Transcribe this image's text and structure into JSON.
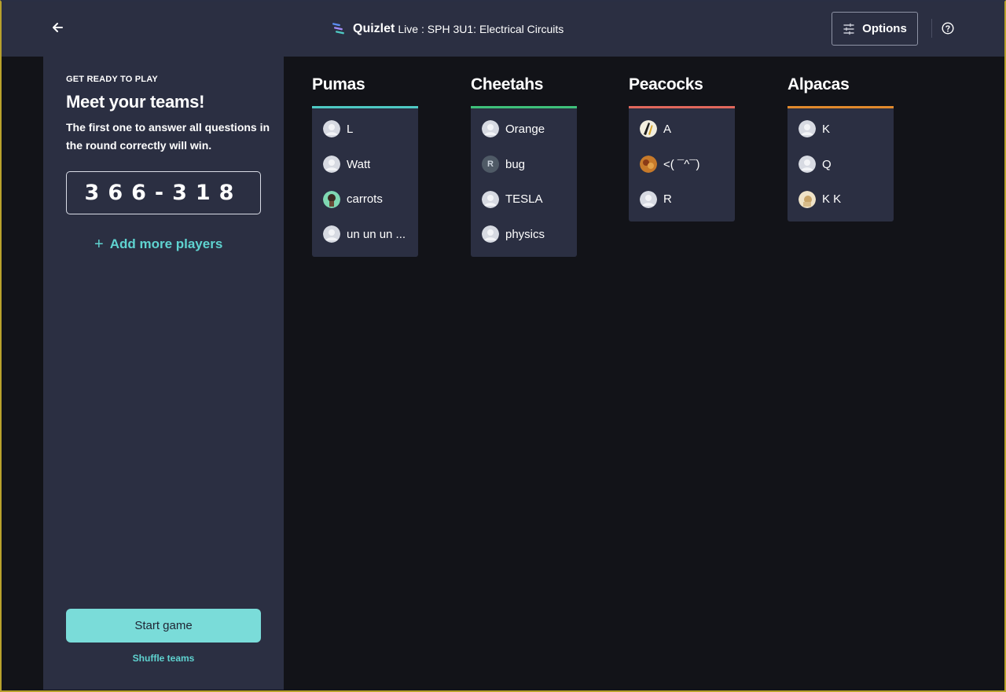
{
  "header": {
    "brand": "Quizlet",
    "mode": "Live",
    "set_title": ": SPH 3U1: Electrical Circuits",
    "options_label": "Options",
    "icons": [
      "arrow-left-icon",
      "quizlet-logo-icon",
      "sliders-icon",
      "help-circle-icon"
    ]
  },
  "sidebar": {
    "kicker": "GET READY TO PLAY",
    "headline": "Meet your teams!",
    "description": "The first one to answer all questions in the round correctly will win.",
    "join_code": "366-318",
    "add_players_label": "Add more players",
    "start_label": "Start game",
    "shuffle_label": "Shuffle teams"
  },
  "colors": {
    "accent": "#5fd3d0",
    "start_button": "#7adcd9",
    "panel": "#2b2f42",
    "background": "#121318"
  },
  "teams": [
    {
      "name": "Pumas",
      "color": "#4ec9c3",
      "players": [
        {
          "name": "L",
          "avatar": "default"
        },
        {
          "name": "Watt",
          "avatar": "default"
        },
        {
          "name": "carrots",
          "avatar": "photo-green"
        },
        {
          "name": "un un un ...",
          "avatar": "default"
        }
      ]
    },
    {
      "name": "Cheetahs",
      "color": "#3ec07a",
      "players": [
        {
          "name": "Orange",
          "avatar": "default"
        },
        {
          "name": "bug",
          "avatar": "initial",
          "initial": "R"
        },
        {
          "name": "TESLA",
          "avatar": "default"
        },
        {
          "name": "physics",
          "avatar": "default"
        }
      ]
    },
    {
      "name": "Peacocks",
      "color": "#e0675c",
      "players": [
        {
          "name": "A",
          "avatar": "photo-stripes"
        },
        {
          "name": "<( ¯^¯)",
          "avatar": "photo-orange"
        },
        {
          "name": "R",
          "avatar": "default"
        }
      ]
    },
    {
      "name": "Alpacas",
      "color": "#e0892c",
      "players": [
        {
          "name": "K",
          "avatar": "default"
        },
        {
          "name": "Q",
          "avatar": "default"
        },
        {
          "name": "K K",
          "avatar": "photo-beige"
        }
      ]
    }
  ]
}
